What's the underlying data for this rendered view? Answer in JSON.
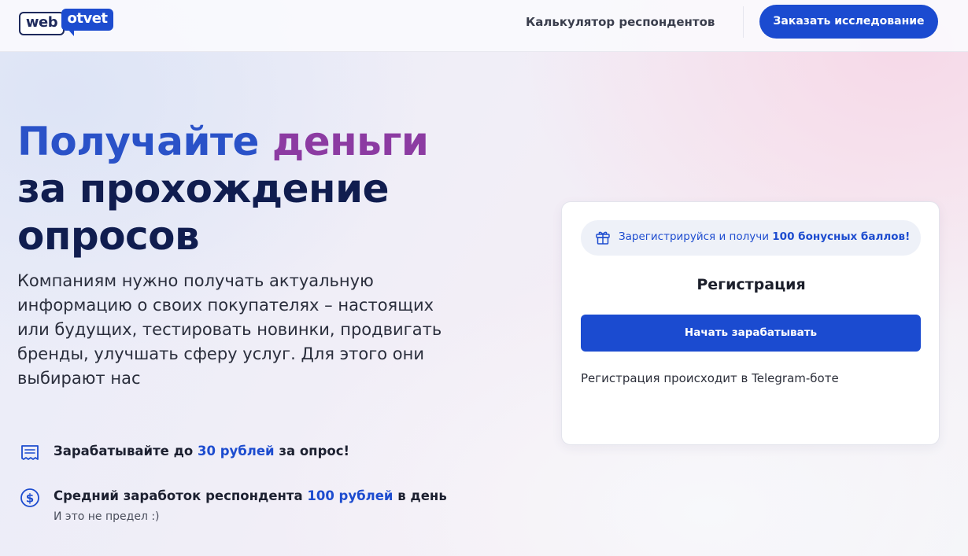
{
  "header": {
    "logo_web": "web",
    "logo_otvet": "otvet",
    "nav_link": "Калькулятор респондентов",
    "order_button": "Заказать исследование"
  },
  "hero": {
    "title_line1_part1": "Получайте",
    "title_line1_part2": "деньги",
    "title_line2": "за прохождение",
    "title_line3": "опросов",
    "lead": "Компаниям нужно получать актуальную информацию о своих покупателях – настоящих или будущих, тестировать новинки, продвигать бренды, улучшать сферу услуг. Для этого они выбирают нас"
  },
  "features": [
    {
      "icon": "receipt-icon",
      "before": "Зарабатывайте до ",
      "highlight": "30 рублей",
      "after": " за опрос!"
    },
    {
      "icon": "dollar-coin-icon",
      "before": "Средний заработок респондента ",
      "highlight": "100 рублей",
      "after": " в день",
      "subtext": "И это не предел :)"
    }
  ],
  "registration": {
    "promo_before": "Зарегистрируйся и получи ",
    "promo_bold": "100 бонусных баллов!",
    "title": "Регистрация",
    "button": "Начать зарабатывать",
    "note": "Регистрация происходит в Telegram-боте"
  },
  "colors": {
    "primary": "#1b4bd0",
    "title_dark": "#101d4f",
    "title_blue": "#2a52c8",
    "title_purple": "#8c3ba2"
  }
}
